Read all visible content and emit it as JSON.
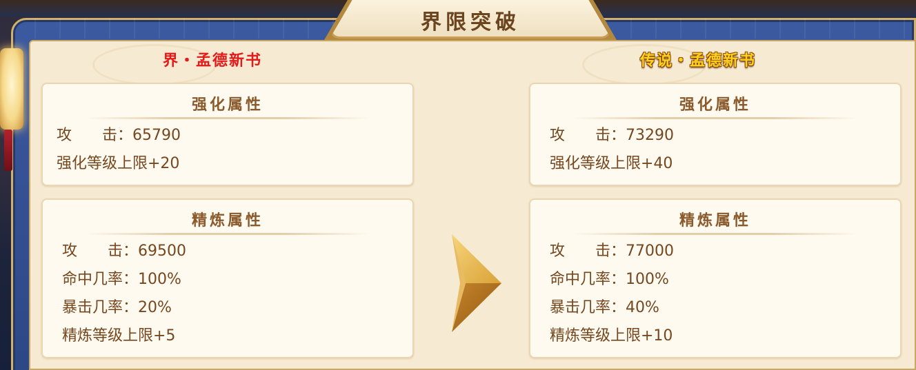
{
  "title": "界限突破",
  "left": {
    "name": "界・孟德新书",
    "enhance": {
      "title": "强化属性",
      "lines": [
        "攻　　击：65790",
        "强化等级上限+20"
      ]
    },
    "refine": {
      "title": "精炼属性",
      "lines": [
        "攻　　击：69500",
        "命中几率：100%",
        "暴击几率：20%",
        "精炼等级上限+5"
      ]
    }
  },
  "right": {
    "name": "传说・孟德新书",
    "enhance": {
      "title": "强化属性",
      "lines": [
        "攻　　击：73290",
        "强化等级上限+40"
      ]
    },
    "refine": {
      "title": "精炼属性",
      "lines": [
        "攻　　击：77000",
        "命中几率：100%",
        "暴击几率：40%",
        "精炼等级上限+10"
      ]
    }
  },
  "colors": {
    "frame_blue": "#3c5aa0",
    "panel_cream": "#f6ead2",
    "text_brown": "#74471f",
    "left_name_red": "#e41a1a",
    "right_name_gold": "#ffd21c"
  },
  "icons": {
    "arrow": "gold-arrow-right-icon",
    "lantern": "lantern-icon"
  }
}
